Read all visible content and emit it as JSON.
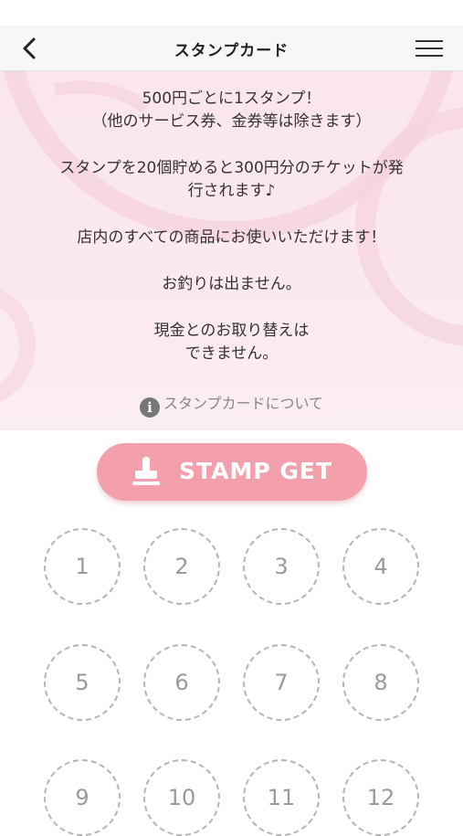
{
  "header": {
    "title": "スタンプカード"
  },
  "info": {
    "lines": [
      "500円ごとに1スタンプ！",
      "（他のサービス券、金券等は除きます）",
      "スタンプを20個貯めると300円分のチケットが発",
      "行されます♪",
      "店内のすべての商品にお使いいただけます！",
      "お釣りは出ません。",
      "現金とのお取り替えは",
      "できません。"
    ],
    "about_link": "スタンプカードについて"
  },
  "stamp_button": {
    "label": "STAMP GET"
  },
  "stamps": [
    "1",
    "2",
    "3",
    "4",
    "5",
    "6",
    "7",
    "8",
    "9",
    "10",
    "11",
    "12"
  ],
  "colors": {
    "accent": "#f3a0ac",
    "info_background": "#fbe6ee",
    "slot_border": "#b5b5b5"
  }
}
